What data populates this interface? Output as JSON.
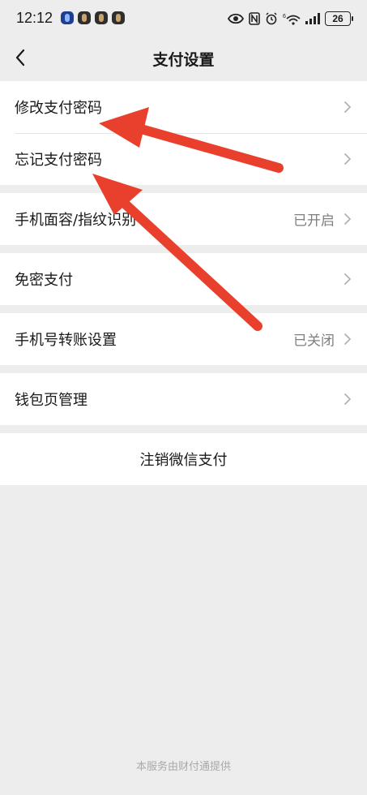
{
  "status_bar": {
    "time": "12:12",
    "battery": "26",
    "network": "6"
  },
  "nav": {
    "title": "支付设置",
    "back_icon": "chevron-left-icon"
  },
  "groups": [
    {
      "rows": [
        {
          "label": "修改支付密码",
          "value": ""
        },
        {
          "label": "忘记支付密码",
          "value": ""
        }
      ]
    },
    {
      "rows": [
        {
          "label": "手机面容/指纹识别",
          "value": "已开启"
        }
      ]
    },
    {
      "rows": [
        {
          "label": "免密支付",
          "value": ""
        }
      ]
    },
    {
      "rows": [
        {
          "label": "手机号转账设置",
          "value": "已关闭"
        }
      ]
    },
    {
      "rows": [
        {
          "label": "钱包页管理",
          "value": ""
        }
      ]
    }
  ],
  "cancel_button": {
    "label": "注销微信支付"
  },
  "footer": {
    "text": "本服务由财付通提供"
  },
  "colors": {
    "background": "#ededed",
    "card": "#ffffff",
    "secondary_text": "#7f7f7f",
    "annotation_arrow": "#e8402c"
  }
}
